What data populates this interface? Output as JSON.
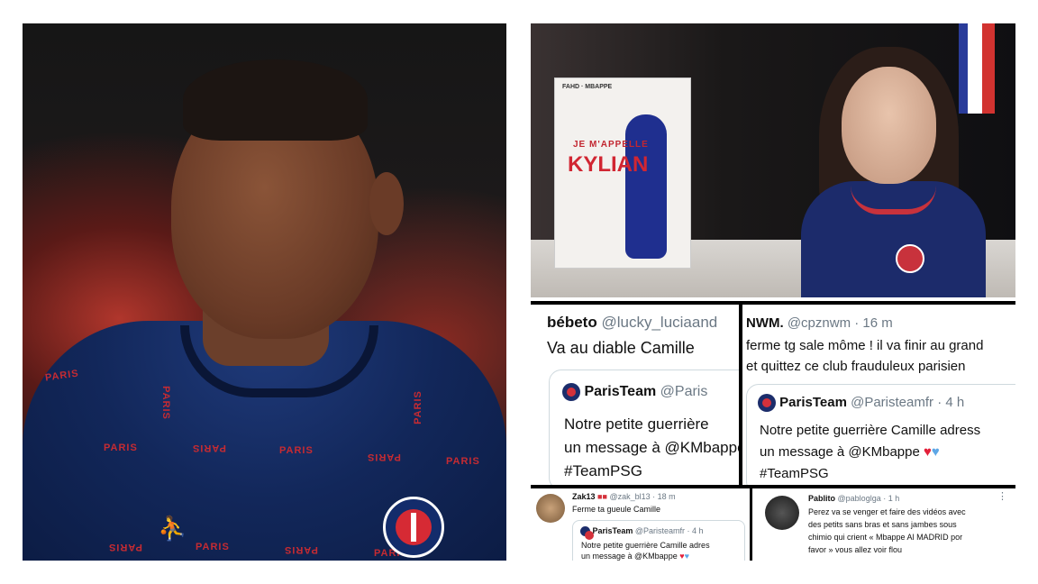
{
  "left_photo": {
    "jersey_words": [
      "PARIS",
      "PARIS",
      "PARIS",
      "PARIS",
      "PARIS",
      "PARIS",
      "PARIS",
      "PARIS",
      "PARIS",
      "PARIS",
      "PARIS",
      "PARIS"
    ],
    "crest_text": "PARIS"
  },
  "video": {
    "book_authors": "FAHD · MBAPPE",
    "book_subtitle": "JE M'APPELLE",
    "book_title": "KYLIAN"
  },
  "tweet1": {
    "name": "bébeto",
    "handle": "@lucky_luciaand",
    "text": "Va au diable Camille",
    "quote_name": "ParisTeam",
    "quote_handle": "@Paris",
    "quote_line1": "Notre petite guerrière",
    "quote_line2": "un message à @KMbappe",
    "quote_line3": "#TeamPSG"
  },
  "tweet2": {
    "name": "NWM.",
    "handle": "@cpznwm · 16 m",
    "text_line1": "ferme tg sale môme ! il va finir au grand",
    "text_line2": "et quittez ce club frauduleux parisien",
    "quote_name": "ParisTeam",
    "quote_handle": "@Paristeamfr · 4 h",
    "quote_line1": "Notre petite guerrière Camille adress",
    "quote_line2": "un message à @KMbappe",
    "quote_line3": "#TeamPSG"
  },
  "tweet3": {
    "name": "Zak13",
    "handle": "@zak_bl13 · 18 m",
    "text": "Ferme ta gueule Camille",
    "quote_name": "ParisTeam",
    "quote_handle": "@Paristeamfr · 4 h",
    "quote_line1": "Notre petite guerrière Camille adres",
    "quote_line2": "un message à @KMbappe"
  },
  "tweet4": {
    "name": "Pablito",
    "handle": "@pabloglga · 1 h",
    "line1": "Perez va se venger et faire des vidéos avec",
    "line2": "des petits sans bras et sans jambes sous",
    "line3": "chimio qui crient « Mbappe Al MADRID por",
    "line4": "favor » vous allez voir flou"
  },
  "colors": {
    "psg_navy": "#1c2d6b",
    "psg_red": "#d4313b",
    "twitter_gray": "#6b7884",
    "heart_red": "#e3203a",
    "heart_blue": "#5ea7e6"
  }
}
